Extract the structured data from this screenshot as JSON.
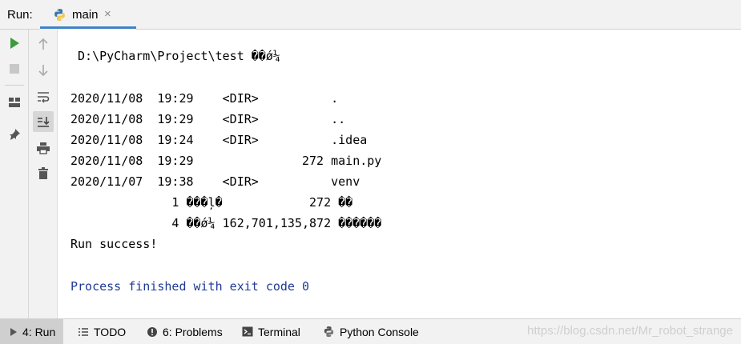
{
  "header": {
    "run_label": "Run:",
    "tab_label": "main",
    "close_glyph": "×"
  },
  "console": {
    "lines": [
      " D:\\PyCharm\\Project\\test ��ǿ¼",
      "2020/11/08  19:29    <DIR>          .",
      "2020/11/08  19:29    <DIR>          ..",
      "2020/11/08  19:24    <DIR>          .idea",
      "2020/11/08  19:29               272 main.py",
      "2020/11/07  19:38    <DIR>          venv",
      "              1 ���ļ�            272 ��",
      "              4 ��ǿ¼ 162,701,135,872 ������",
      "Run success!",
      "Process finished with exit code 0"
    ]
  },
  "bottom": {
    "run_tab": "4: Run",
    "todo_tab": "TODO",
    "problems_tab": "6: Problems",
    "terminal_tab": "Terminal",
    "python_console_tab": "Python Console",
    "watermark": "https://blog.csdn.net/Mr_robot_strange"
  },
  "colors": {
    "run_green": "#3c9b3c",
    "exit_blue": "#1f3a93",
    "tab_accent": "#4083c9"
  }
}
